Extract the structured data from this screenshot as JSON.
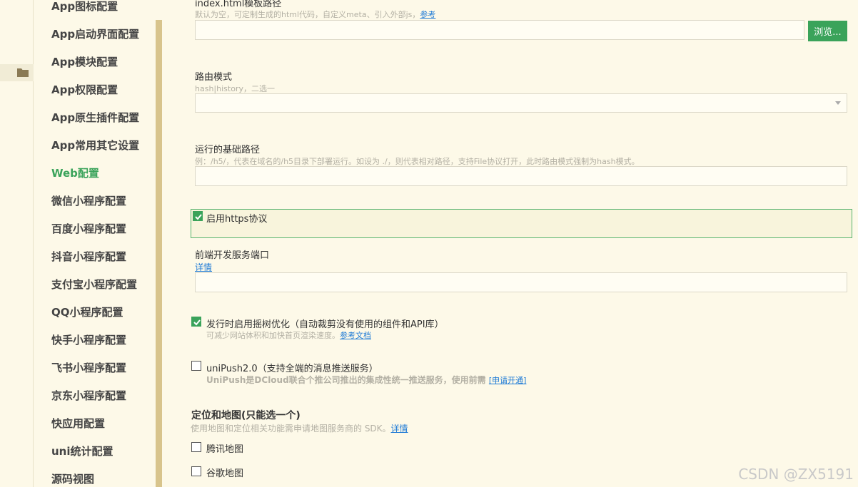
{
  "nav": {
    "items": [
      {
        "label": "App图标配置",
        "active": false
      },
      {
        "label": "App启动界面配置",
        "active": false
      },
      {
        "label": "App模块配置",
        "active": false
      },
      {
        "label": "App权限配置",
        "active": false
      },
      {
        "label": "App原生插件配置",
        "active": false
      },
      {
        "label": "App常用其它设置",
        "active": false
      },
      {
        "label": "Web配置",
        "active": true
      },
      {
        "label": "微信小程序配置",
        "active": false
      },
      {
        "label": "百度小程序配置",
        "active": false
      },
      {
        "label": "抖音小程序配置",
        "active": false
      },
      {
        "label": "支付宝小程序配置",
        "active": false
      },
      {
        "label": "QQ小程序配置",
        "active": false
      },
      {
        "label": "快手小程序配置",
        "active": false
      },
      {
        "label": "飞书小程序配置",
        "active": false
      },
      {
        "label": "京东小程序配置",
        "active": false
      },
      {
        "label": "快应用配置",
        "active": false
      },
      {
        "label": "uni统计配置",
        "active": false
      },
      {
        "label": "源码视图",
        "active": false
      }
    ]
  },
  "main": {
    "template_path": {
      "label": "index.html模板路径",
      "hint": "默认为空，可定制生成的html代码，自定义meta、引入外部js，",
      "hint_link": "参考",
      "value": "",
      "browse_label": "浏览..."
    },
    "router_mode": {
      "label": "路由模式",
      "hint": "hash|history，二选一",
      "value": ""
    },
    "base_path": {
      "label": "运行的基础路径",
      "hint": "例：/h5/，代表在域名的/h5目录下部署运行。如设为 ./，则代表相对路径，支持File协议打开，此时路由模式强制为hash模式。",
      "value": ""
    },
    "https": {
      "label": "启用https协议",
      "checked": true
    },
    "dev_port": {
      "label": "前端开发服务端口",
      "link": "详情",
      "value": ""
    },
    "treeshaking": {
      "label": "发行时启用摇树优化（自动裁剪没有使用的组件和API库）",
      "hint": "可减少网站体积和加快首页渲染速度。",
      "hint_link": "参考文档",
      "checked": true
    },
    "unipush": {
      "label": "uniPush2.0（支持全端的消息推送服务）",
      "hint": "UniPush是DCloud联合个推公司推出的集成性统一推送服务，使用前需",
      "hint_link": "[申请开通]",
      "checked": false
    },
    "maps": {
      "title": "定位和地图(只能选一个)",
      "hint": "使用地图和定位相关功能需申请地图服务商的 SDK。",
      "hint_link": "详情",
      "options": [
        {
          "label": "腾讯地图",
          "checked": false
        },
        {
          "label": "谷歌地图",
          "checked": false
        }
      ]
    }
  },
  "watermark": "CSDN @ZX5191",
  "colors": {
    "accent": "#3aa35a",
    "link": "#1f7bd6",
    "background": "#fdf9e8"
  }
}
